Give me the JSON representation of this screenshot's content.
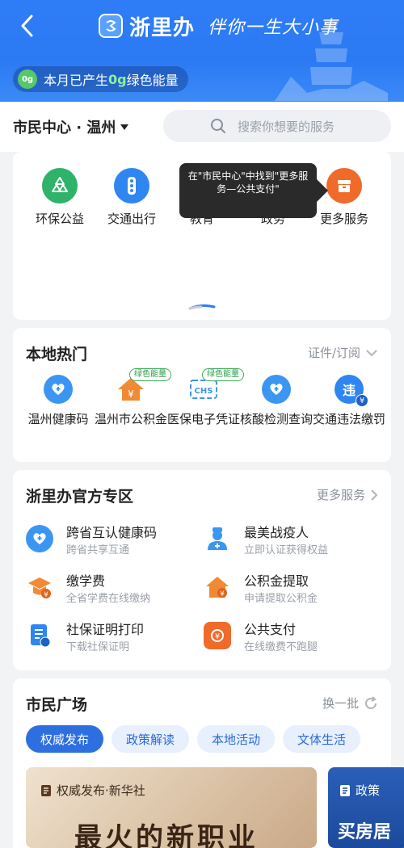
{
  "header": {
    "title": "浙里办",
    "slogan": "伴你一生大小事",
    "energy_prefix": "本月已产生",
    "energy_value": "0g",
    "energy_suffix": "绿色能量",
    "energy_leaf_text": "0g"
  },
  "topbar": {
    "city": "市民中心 · 温州",
    "search_placeholder": "搜索你想要的服务"
  },
  "quick": {
    "items": [
      {
        "label": "环保公益",
        "icon": "recycle-icon",
        "color": "#2fb36a"
      },
      {
        "label": "交通出行",
        "icon": "traffic-light-icon",
        "color": "#2f86f0"
      },
      {
        "label": "教育",
        "icon": "education-icon",
        "color": "#f08a34"
      },
      {
        "label": "政务",
        "icon": "government-icon",
        "color": "#f08a34"
      },
      {
        "label": "更多服务",
        "icon": "box-icon",
        "color": "#f06a2a"
      }
    ],
    "tooltip": "在\"市民中心\"中找到\"更多服务—公共支付\""
  },
  "hot": {
    "title": "本地热门",
    "more": "证件/订阅",
    "items": [
      {
        "label": "温州健康码",
        "icon": "health-code-icon",
        "badge": ""
      },
      {
        "label": "温州市公积金",
        "icon": "housing-fund-icon",
        "badge": "绿色能量"
      },
      {
        "label": "医保电子凭证",
        "icon": "chs-icon",
        "badge": "绿色能量"
      },
      {
        "label": "核酸检测查询",
        "icon": "nucleic-test-icon",
        "badge": ""
      },
      {
        "label": "交通违法缴罚",
        "icon": "traffic-violation-icon",
        "badge": ""
      }
    ]
  },
  "official": {
    "title": "浙里办官方专区",
    "more": "更多服务",
    "items": [
      {
        "title": "跨省互认健康码",
        "sub": "跨省共享互通",
        "icon": "health-heart-icon"
      },
      {
        "title": "最美战疫人",
        "sub": "立即认证获得权益",
        "icon": "nurse-icon"
      },
      {
        "title": "缴学费",
        "sub": "全省学费在线缴纳",
        "icon": "tuition-icon"
      },
      {
        "title": "公积金提取",
        "sub": "申请提取公积金",
        "icon": "fund-withdraw-icon"
      },
      {
        "title": "社保证明打印",
        "sub": "下载社保证明",
        "icon": "social-security-icon"
      },
      {
        "title": "公共支付",
        "sub": "在线缴费不跑腿",
        "icon": "public-payment-icon"
      }
    ]
  },
  "plaza": {
    "title": "市民广场",
    "refresh": "换一批",
    "tabs": [
      "权威发布",
      "政策解读",
      "本地活动",
      "文体生活"
    ],
    "news1_tag": "权威发布·新华社",
    "news1_headline": "最火的新职业",
    "news2_tag": "政策",
    "news2_headline": "买房居"
  },
  "colors": {
    "brand_blue": "#2f7cf6",
    "green_badge": "#3cae5a",
    "orange": "#f08a34"
  }
}
